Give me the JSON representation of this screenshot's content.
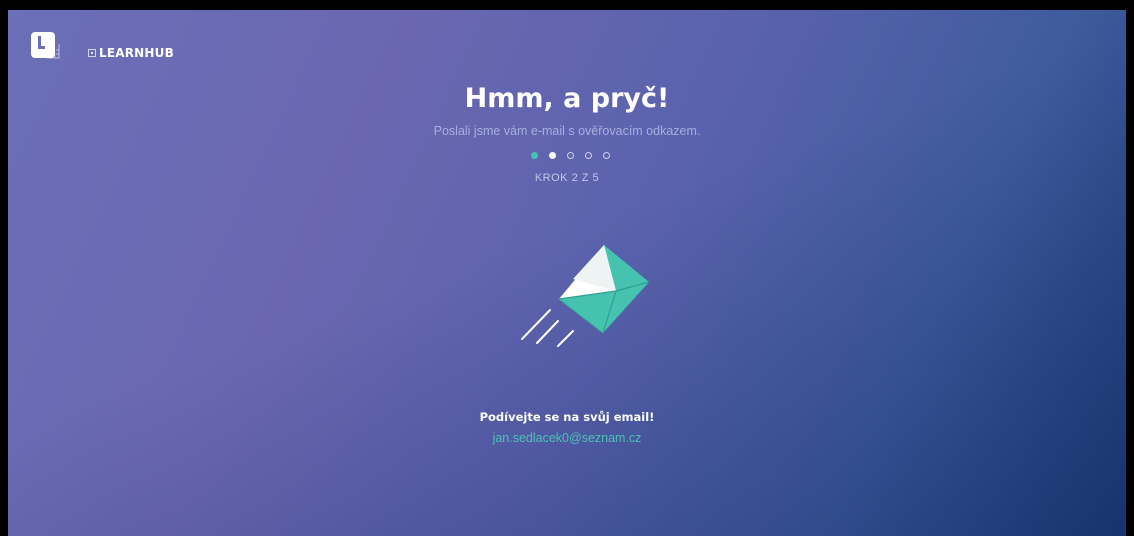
{
  "header": {
    "logo_letter": "L",
    "brand_name": "LEARNHUB"
  },
  "main": {
    "title": "Hmm, a pryč!",
    "subtitle": "Poslali jsme vám e-mail s ověřovacím odkazem.",
    "progress": {
      "current_step": 2,
      "total_steps": 5,
      "label": "KROK 2 Z 5"
    },
    "illustration": "flying-envelope-icon",
    "check_text": "Podívejte se na svůj email!",
    "email": "jan.sedlacek0@seznam.cz"
  },
  "colors": {
    "accent": "#45c3b0",
    "background_start": "#6a6fb8",
    "background_end": "#1d3f78",
    "envelope": "#45c3b0"
  }
}
